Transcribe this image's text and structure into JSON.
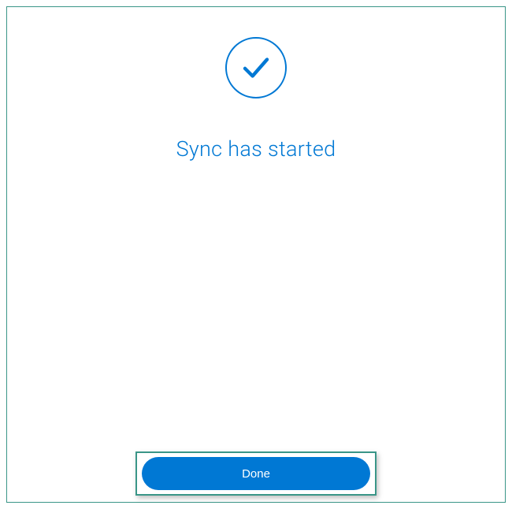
{
  "status": {
    "title": "Sync has started",
    "icon": "checkmark-icon"
  },
  "actions": {
    "done_label": "Done"
  },
  "colors": {
    "primary": "#0078d4",
    "highlight_border": "#3a9688"
  }
}
